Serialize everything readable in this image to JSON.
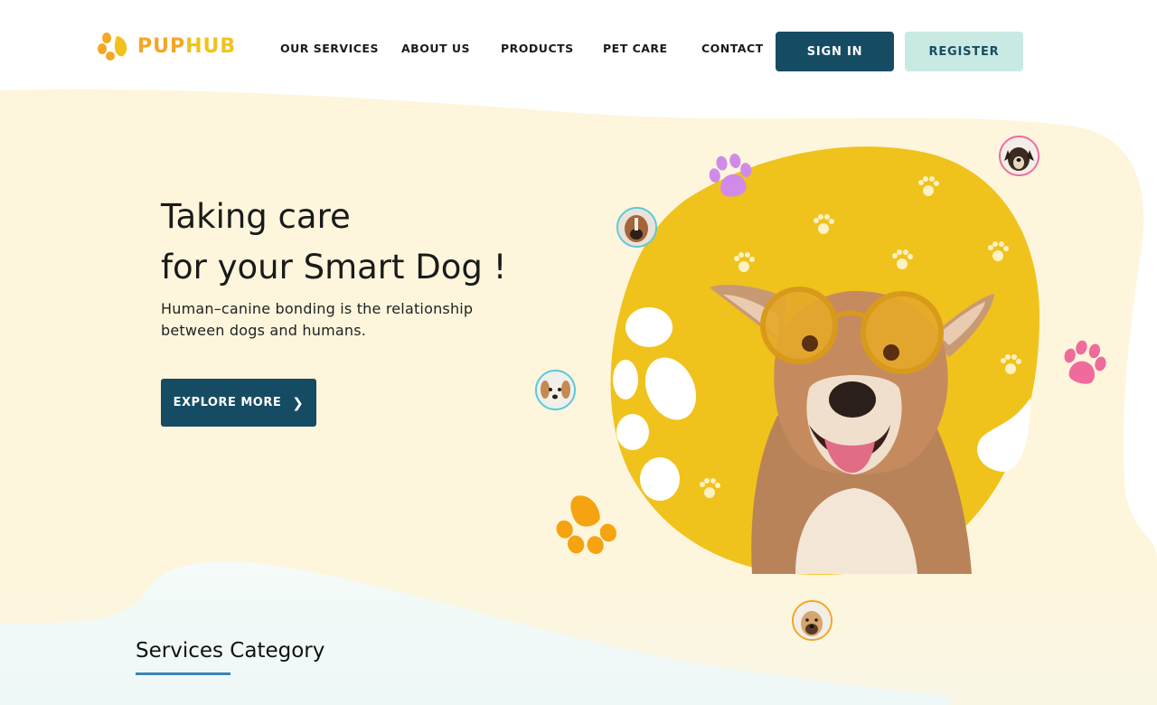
{
  "brand": {
    "name_part1": "PUP",
    "name_part2": "HUB"
  },
  "nav": {
    "links": [
      "OUR SERVICES",
      "ABOUT US",
      "PRODUCTS",
      "PET CARE",
      "CONTACT"
    ],
    "signin_label": "SIGN IN",
    "register_label": "REGISTER"
  },
  "hero": {
    "title_line1": "Taking care",
    "title_line2": "for your Smart Dog !",
    "subtitle_line1": "Human–canine bonding is the relationship",
    "subtitle_line2": "between dogs and humans.",
    "cta_label": "EXPLORE MORE",
    "cta_icon": "chevron-right-icon"
  },
  "section": {
    "title": "Services Category"
  },
  "colors": {
    "primary": "#164c63",
    "secondary": "#c9e9e3",
    "brand_orange": "#f5a623",
    "blob_yellow": "#f0c21c",
    "cream": "#fdf6dc",
    "paw_purple": "#d08be8",
    "paw_pink": "#f06b9c",
    "paw_orange": "#f5a310",
    "underline": "#3a86b5"
  },
  "icons": [
    "logo-paw-icon",
    "paw-icon",
    "chevron-right-icon",
    "dog-avatar"
  ]
}
